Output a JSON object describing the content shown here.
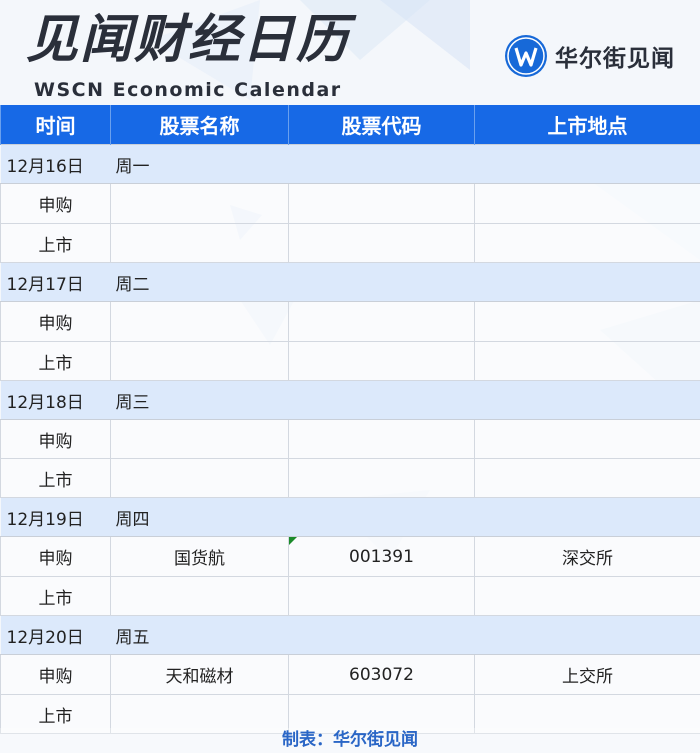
{
  "header": {
    "title_cn": "见闻财经日历",
    "title_en": "WSCN Economic Calendar",
    "logo_text": "华尔街见闻",
    "logo_icon": "wscn-w-logo-icon"
  },
  "table": {
    "columns": [
      "时间",
      "股票名称",
      "股票代码",
      "上市地点"
    ],
    "days": [
      {
        "date": "12月16日",
        "weekday": "周一",
        "rows": [
          {
            "kind": "申购",
            "name": "",
            "code": "",
            "place": ""
          },
          {
            "kind": "上市",
            "name": "",
            "code": "",
            "place": ""
          }
        ]
      },
      {
        "date": "12月17日",
        "weekday": "周二",
        "rows": [
          {
            "kind": "申购",
            "name": "",
            "code": "",
            "place": ""
          },
          {
            "kind": "上市",
            "name": "",
            "code": "",
            "place": ""
          }
        ]
      },
      {
        "date": "12月18日",
        "weekday": "周三",
        "rows": [
          {
            "kind": "申购",
            "name": "",
            "code": "",
            "place": ""
          },
          {
            "kind": "上市",
            "name": "",
            "code": "",
            "place": ""
          }
        ]
      },
      {
        "date": "12月19日",
        "weekday": "周四",
        "rows": [
          {
            "kind": "申购",
            "name": "国货航",
            "code": "001391",
            "place": "深交所"
          },
          {
            "kind": "上市",
            "name": "",
            "code": "",
            "place": ""
          }
        ]
      },
      {
        "date": "12月20日",
        "weekday": "周五",
        "rows": [
          {
            "kind": "申购",
            "name": "天和磁材",
            "code": "603072",
            "place": "上交所"
          },
          {
            "kind": "上市",
            "name": "",
            "code": "",
            "place": ""
          }
        ]
      }
    ]
  },
  "footer": {
    "text": "制表：华尔街见闻"
  },
  "colors": {
    "header_blue": "#1769e6",
    "day_row_bg": "#dce9fb",
    "footer_text": "#2a66c6",
    "title_text": "#2a2f3a"
  }
}
